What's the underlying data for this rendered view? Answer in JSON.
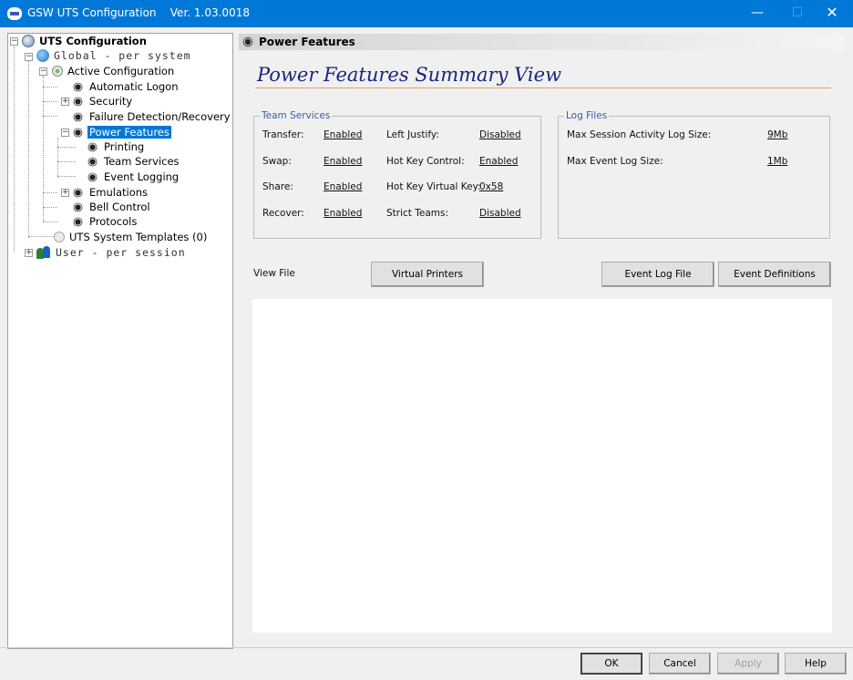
{
  "window": {
    "title": "GSW UTS Configuration    Ver. 1.03.0018",
    "minimize": "—",
    "maximize": "☐",
    "close": "✕"
  },
  "tree": {
    "root": "UTS Configuration",
    "global": "Global  - per system",
    "active_configuration": "Active Configuration",
    "items": [
      "Automatic Logon",
      "Security",
      "Failure Detection/Recovery",
      "Power Features",
      "Printing",
      "Team Services",
      "Event Logging",
      "Emulations",
      "Bell Control",
      "Protocols"
    ],
    "templates": "UTS System Templates (0)",
    "user": "User  - per session",
    "selected": "Power Features"
  },
  "panel": {
    "header": "Power Features",
    "summary_title": "Power Features Summary View"
  },
  "team_services": {
    "legend": "Team Services",
    "rows": [
      {
        "label": "Transfer:",
        "value": "Enabled",
        "label2": "Left Justify:",
        "value2": "Disabled"
      },
      {
        "label": "Swap:",
        "value": "Enabled",
        "label2": "Hot Key Control:",
        "value2": "Enabled"
      },
      {
        "label": "Share:",
        "value": "Enabled",
        "label2": "Hot Key Virtual Key:",
        "value2": "0x58"
      },
      {
        "label": "Recover:",
        "value": "Enabled",
        "label2": "Strict Teams:",
        "value2": "Disabled"
      }
    ]
  },
  "log_files": {
    "legend": "Log Files",
    "rows": [
      {
        "label": "Max Session Activity Log Size:",
        "value": "9Mb"
      },
      {
        "label": "Max Event Log Size:",
        "value": "1Mb"
      }
    ]
  },
  "view": {
    "label": "View File",
    "virtual_printers": "Virtual Printers",
    "event_log_file": "Event Log File",
    "event_definitions": "Event Definitions"
  },
  "footer": {
    "ok": "OK",
    "cancel": "Cancel",
    "apply": "Apply",
    "help": "Help"
  }
}
